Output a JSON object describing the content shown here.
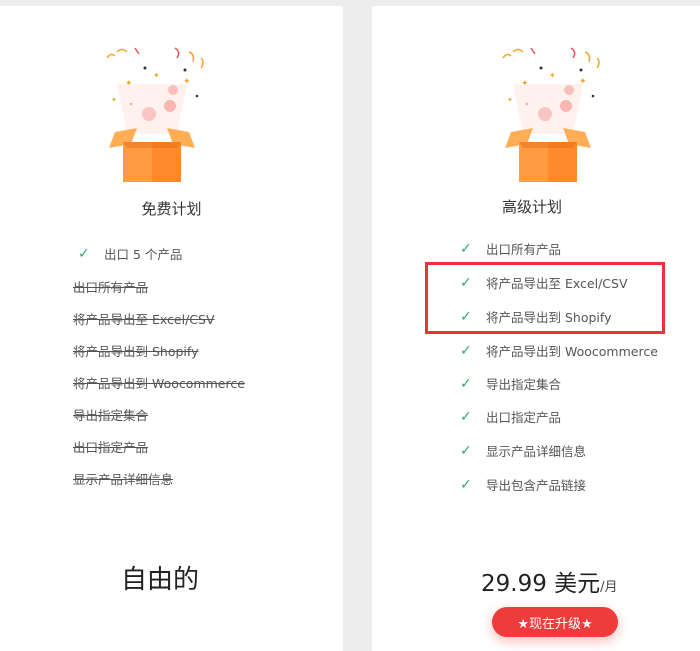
{
  "free_plan": {
    "title": "免费计划",
    "included": [
      {
        "label": "出口 5 个产品"
      }
    ],
    "excluded": [
      {
        "label": "出口所有产品"
      },
      {
        "label": "将产品导出至 Excel/CSV"
      },
      {
        "label": "将产品导出到 Shopify"
      },
      {
        "label": "将产品导出到 Woocommerce"
      },
      {
        "label": "导出指定集合"
      },
      {
        "label": "出口指定产品"
      },
      {
        "label": "显示产品详细信息"
      }
    ],
    "price": "自由的"
  },
  "pro_plan": {
    "title": "高级计划",
    "features": [
      {
        "label": "出口所有产品"
      },
      {
        "label": "将产品导出至 Excel/CSV"
      },
      {
        "label": "将产品导出到 Shopify"
      },
      {
        "label": "将产品导出到 Woocommerce"
      },
      {
        "label": "导出指定集合"
      },
      {
        "label": "出口指定产品"
      },
      {
        "label": "显示产品详细信息"
      },
      {
        "label": "导出包含产品链接"
      }
    ],
    "price_amount": "29.99 美元",
    "price_unit": "/月",
    "upgrade_label": "★现在升级★"
  },
  "icons": {
    "check": "check-icon",
    "gift": "gift-box-icon"
  },
  "colors": {
    "accent_green": "#2daa6a",
    "button_red": "#ee3b3b",
    "highlight_red": "#e83434",
    "gift_orange": "#ff8a2b"
  }
}
